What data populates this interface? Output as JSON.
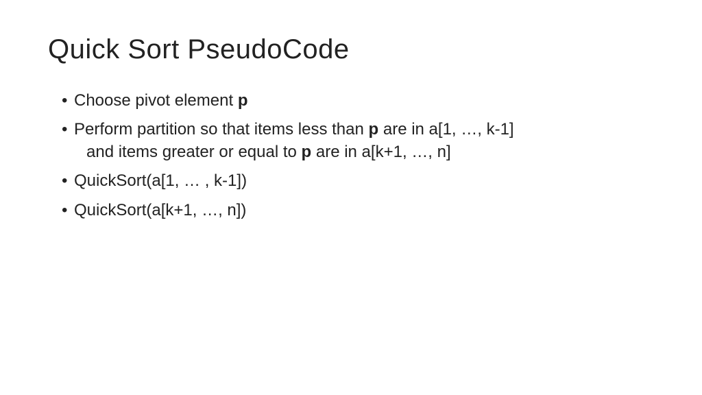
{
  "title": "Quick Sort PseudoCode",
  "bullets": {
    "b1_pre": "Choose pivot element ",
    "b1_bold": "p",
    "b2_line1_pre": "Perform partition so that items less than ",
    "b2_line1_bold": "p",
    "b2_line1_post": " are in a[1, …, k-1]",
    "b2_line2_pre": "and items greater or equal to ",
    "b2_line2_bold": "p",
    "b2_line2_post": " are in a[k+1, …, n]",
    "b3": "QuickSort(a[1, … , k-1])",
    "b4": "QuickSort(a[k+1, …, n])"
  }
}
